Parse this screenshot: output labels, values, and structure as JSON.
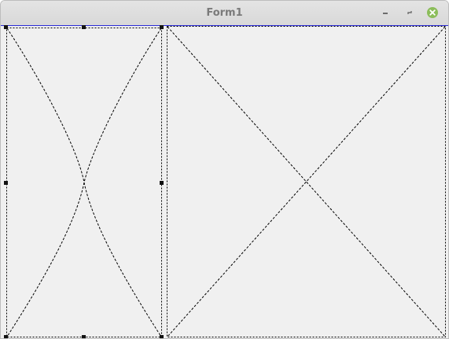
{
  "window": {
    "title": "Form1",
    "controls": {
      "minimize_icon": "minimize-icon",
      "maximize_icon": "restore-icon",
      "close_icon": "close-icon",
      "close_color": "#8bbd5a"
    }
  },
  "designer": {
    "placeholders": [
      {
        "name": "placeholder-panel-left",
        "selected": true
      },
      {
        "name": "placeholder-panel-right",
        "selected": false
      }
    ],
    "accent": "#2b2bd6"
  }
}
